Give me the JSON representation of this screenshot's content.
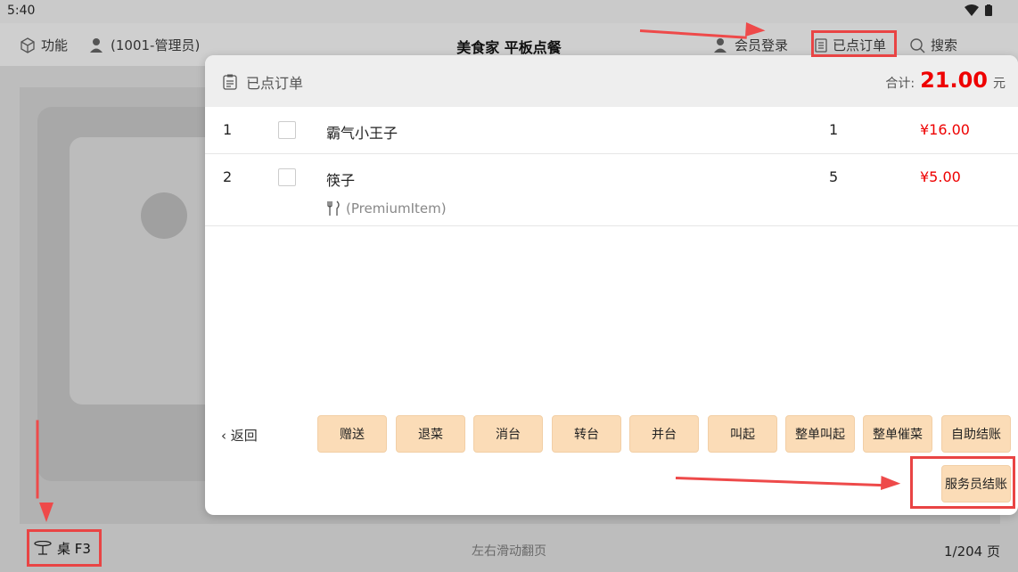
{
  "status": {
    "time": "5:40"
  },
  "topbar": {
    "function_label": "功能",
    "user_label": "(1001-管理员)",
    "title": "美食家 平板点餐",
    "member_login": "会员登录",
    "ordered": "已点订单",
    "search": "搜索"
  },
  "modal": {
    "title": "已点订单",
    "total_label": "合计:",
    "total_amount": "21.00",
    "total_unit": "元",
    "items": [
      {
        "index": "1",
        "name": "霸气小王子",
        "qty": "1",
        "price": "¥16.00",
        "sub": ""
      },
      {
        "index": "2",
        "name": "筷子",
        "qty": "5",
        "price": "¥5.00",
        "sub": "(PremiumItem)"
      }
    ],
    "back_label": "返回",
    "buttons": [
      "赠送",
      "退菜",
      "消台",
      "转台",
      "并台",
      "叫起",
      "整单叫起",
      "整单催菜",
      "自助结账"
    ],
    "waiter_checkout": "服务员结账"
  },
  "bottom": {
    "table_label": "桌 F3",
    "hint": "左右滑动翻页",
    "page": "1/204 页"
  }
}
